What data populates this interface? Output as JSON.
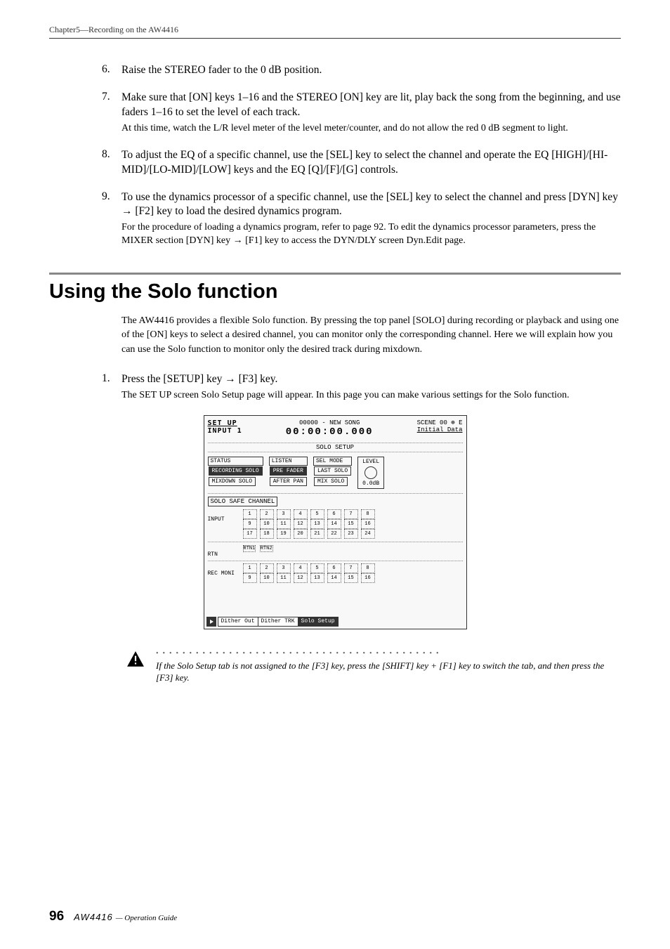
{
  "chapter_header": "Chapter5—Recording on the AW4416",
  "steps_a": [
    {
      "n": "6.",
      "main": "Raise the STEREO fader to the 0 dB position.",
      "sub": ""
    },
    {
      "n": "7.",
      "main": "Make sure that [ON] keys 1–16 and the STEREO [ON] key are lit, play back the song from the beginning, and use faders 1–16 to set the level of each track.",
      "sub": "At this time, watch the L/R level meter of the level meter/counter, and do not allow the red 0 dB segment to light."
    },
    {
      "n": "8.",
      "main": "To adjust the EQ of a specific channel, use the [SEL] key to select the channel and operate the EQ [HIGH]/[HI-MID]/[LO-MID]/[LOW] keys and the EQ [Q]/[F]/[G] controls.",
      "sub": ""
    },
    {
      "n": "9.",
      "main": "To use the dynamics processor of a specific channel, use the [SEL] key to select the channel and press [DYN] key → [F2] key to load the desired dynamics program.",
      "sub": "For the procedure of loading a dynamics program, refer to page 92. To edit the dynamics processor parameters, press the MIXER section [DYN] key → [F1] key to access the DYN/DLY screen Dyn.Edit page."
    }
  ],
  "section_title": "Using the Solo function",
  "section_intro": "The AW4416 provides a flexible Solo function. By pressing the top panel [SOLO] during recording or playback and using one of the [ON] keys to select a desired channel, you can monitor only the corresponding channel. Here we will explain how you can use the Solo function to monitor only the desired track during mixdown.",
  "steps_b": [
    {
      "n": "1.",
      "main": "Press the [SETUP] key → [F3] key.",
      "sub": "The SET UP screen Solo Setup page will appear. In this page you can make various settings for the Solo function."
    }
  ],
  "screen": {
    "title": "SET UP",
    "input_label": "INPUT 1",
    "song": "00000 - NEW SONG",
    "time": "00:00:00.000",
    "scene": "SCENE 00",
    "initial": "Initial Data",
    "indicator": "⊕ E",
    "setup_label": "SOLO SETUP",
    "status_label": "STATUS",
    "listen_label": "LISTEN",
    "sel_mode_label": "SEL MODE",
    "level_label": "LEVEL",
    "recording_solo": "RECORDING SOLO",
    "mixdown_solo": "MIXDOWN SOLO",
    "pre_fader": "PRE FADER",
    "after_pan": "AFTER PAN",
    "last_solo": "LAST SOLO",
    "mix_solo": "MIX SOLO",
    "level_db": "0.0dB",
    "safe_channel": "SOLO SAFE CHANNEL",
    "input_row": "INPUT",
    "rtn_row": "RTN",
    "rec_moni": "REC MONI",
    "rtn1": "RTN1",
    "rtn2": "RTN2",
    "tabs": {
      "t1": "Dither Out",
      "t2": "Dither TRK",
      "t3": "Solo Setup"
    },
    "input_buttons_r1": [
      "1",
      "2",
      "3",
      "4",
      "5",
      "6",
      "7",
      "8"
    ],
    "input_buttons_r2": [
      "9",
      "10",
      "11",
      "12",
      "13",
      "14",
      "15",
      "16"
    ],
    "input_buttons_r3": [
      "17",
      "18",
      "19",
      "20",
      "21",
      "22",
      "23",
      "24"
    ],
    "rec_buttons_r1": [
      "1",
      "2",
      "3",
      "4",
      "5",
      "6",
      "7",
      "8"
    ],
    "rec_buttons_r2": [
      "9",
      "10",
      "11",
      "12",
      "13",
      "14",
      "15",
      "16"
    ]
  },
  "note": "If the Solo Setup tab is not assigned to the [F3] key, press the [SHIFT] key + [F1] key to switch the tab, and then press the [F3] key.",
  "footer": {
    "page": "96",
    "logo": "AW4416",
    "sub": "— Operation Guide"
  }
}
